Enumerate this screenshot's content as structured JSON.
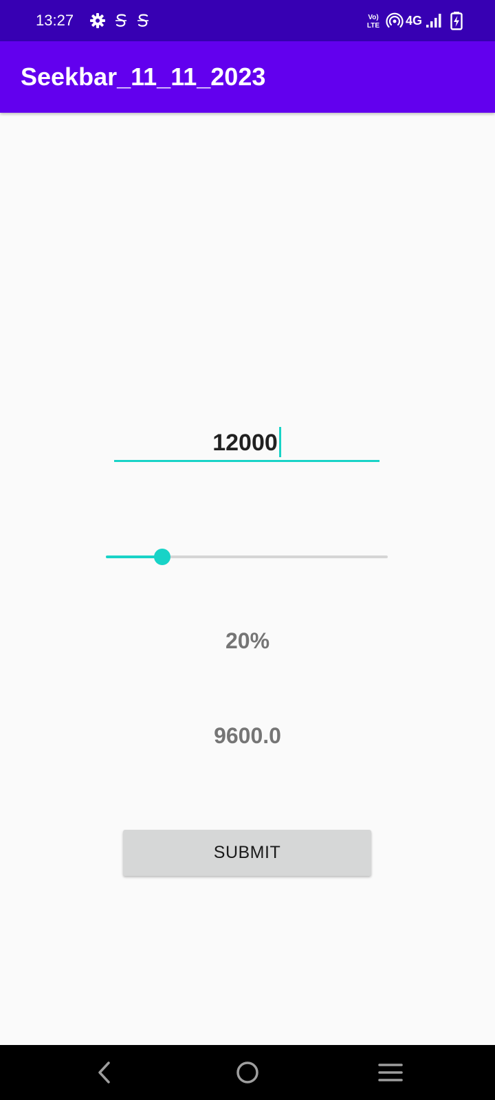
{
  "status_bar": {
    "time": "13:27",
    "left_icons": [
      "gear-icon",
      "s-notification-icon",
      "s-notification-icon"
    ],
    "right_icons": [
      "volte-icon",
      "hotspot-icon",
      "network-4g-icon",
      "signal-icon",
      "battery-charging-icon"
    ],
    "network_label": "4G",
    "volte_top": "Vo)",
    "volte_bottom": "LTE"
  },
  "app_bar": {
    "title": "Seekbar_11_11_2023"
  },
  "amount_input": {
    "value": "12000"
  },
  "seekbar": {
    "progress_fraction": 0.2
  },
  "percent_label": "20%",
  "result_label": "9600.0",
  "submit_button": {
    "label": "SUBMIT"
  },
  "colors": {
    "status_bar": "#3700b3",
    "app_bar": "#6200ee",
    "accent": "#18d3c7",
    "background": "#fafafa",
    "button": "#d6d7d7",
    "secondary_text": "#757575"
  },
  "nav_bar": {
    "buttons": [
      "back-icon",
      "home-icon",
      "recents-icon"
    ]
  }
}
